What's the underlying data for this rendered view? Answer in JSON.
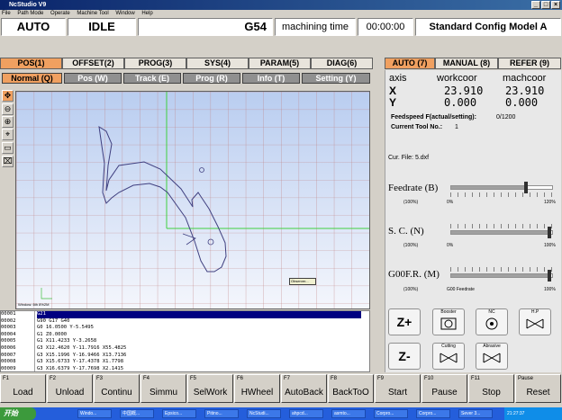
{
  "window": {
    "title": "NcStudio V9",
    "menus": [
      "File",
      "Path Mode",
      "Operate",
      "Machine Tool",
      "Window",
      "Help"
    ]
  },
  "status": {
    "mode": "AUTO",
    "state": "IDLE",
    "coord_sys": "G54",
    "machining_label": "machining time",
    "machining_time": "00:00:00",
    "config": "Standard Config Model A"
  },
  "main_tabs": [
    "POS(1)",
    "OFFSET(2)",
    "PROG(3)",
    "SYS(4)",
    "PARAM(5)",
    "DIAG(6)"
  ],
  "sub_tabs": [
    "Normal (Q)",
    "Pos (W)",
    "Track (E)",
    "Prog (R)",
    "Info (T)",
    "Setting (Y)"
  ],
  "right_tabs": [
    "AUTO (7)",
    "MANUAL (8)",
    "REFER (9)"
  ],
  "axes": {
    "header": [
      "axis",
      "workcoor",
      "machcoor"
    ],
    "rows": [
      {
        "axis": "X",
        "work": "23.910",
        "mach": "23.910"
      },
      {
        "axis": "Y",
        "work": "0.000",
        "mach": "0.000"
      }
    ]
  },
  "feedspeed": {
    "label": "Feedspeed F(actual/setting):",
    "value": "0/1200"
  },
  "tool": {
    "label": "Current Tool No.:",
    "value": "1"
  },
  "cur_file": "Cur. File: 5.dxf",
  "sliders": [
    {
      "label": "Feedrate (B)",
      "left": "(100%)",
      "mid": "0%",
      "right": "120%",
      "level": 0.76
    },
    {
      "label": "S. C. (N)",
      "left": "(100%)",
      "mid": "0%",
      "right": "100%",
      "level": 1.0
    },
    {
      "label": "G00F.R. (M)",
      "left": "(100%)",
      "mid": "G00 Feedrate",
      "right": "100%",
      "level": 1.0
    }
  ],
  "jog": {
    "zplus": "Z+",
    "zminus": "Z-"
  },
  "io_buttons": [
    "Booster",
    "NC",
    "H.P",
    "Cutting",
    "Abrasive"
  ],
  "canvas": {
    "status": "Window: 6th 8%2M",
    "marker_label": "Observer..."
  },
  "gcode": {
    "line_numbers": [
      "00001",
      "00002",
      "00003",
      "00004",
      "00005",
      "00006",
      "00007",
      "00008",
      "00009"
    ],
    "lines": [
      "G21",
      "G90 G17 G40",
      "G0 16.0500 Y-5.5495",
      "G1 Z0.0000",
      "G1 X11.4233 Y-3.2658",
      "G3 X12.4620 Y-11.7916 X55.4825",
      "G3 X15.1996 Y-16.9466 X13.7136",
      "G3 X15.6733 Y-17.4378 X1.7798",
      "G3 X16.6379 Y-17.7698 X2.1415"
    ]
  },
  "fkeys": [
    {
      "fn": "F1",
      "label": "Load"
    },
    {
      "fn": "F2",
      "label": "Unload"
    },
    {
      "fn": "F3",
      "label": "Continu"
    },
    {
      "fn": "F4",
      "label": "Simmu"
    },
    {
      "fn": "F5",
      "label": "SelWork"
    },
    {
      "fn": "F6",
      "label": "HWheel"
    },
    {
      "fn": "F7",
      "label": "AutoBack"
    },
    {
      "fn": "F8",
      "label": "BackToO"
    },
    {
      "fn": "F9",
      "label": "Start"
    },
    {
      "fn": "F10",
      "label": "Pause"
    },
    {
      "fn": "F11",
      "label": "Stop"
    },
    {
      "fn": "Pause",
      "label": "Reset"
    }
  ],
  "taskbar": {
    "start": "开始",
    "tasks": [
      "Windo...",
      "中国概...",
      "Epsico...",
      "Pitino...",
      "NcStudi...",
      "ahpcd...",
      "asmto...",
      "Corpro...",
      "Corpro...",
      "Sever 3..."
    ],
    "clock": "21:27:37"
  }
}
